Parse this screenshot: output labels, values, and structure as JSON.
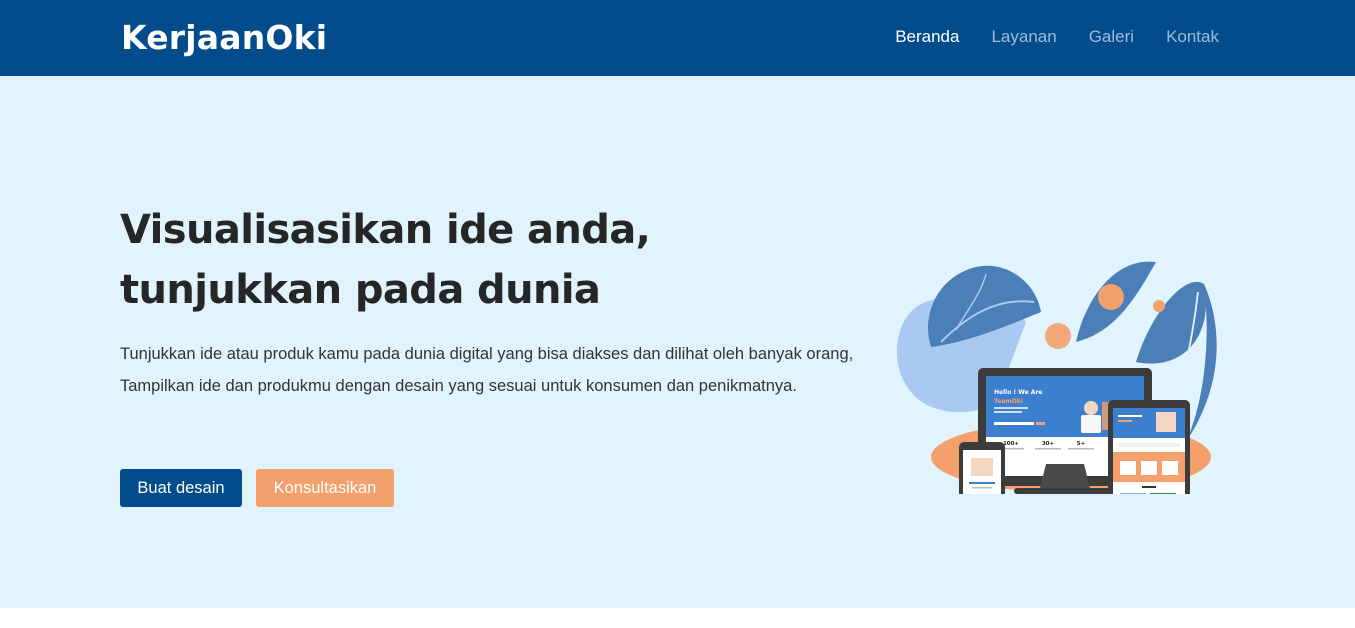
{
  "header": {
    "brand": "KerjaanOki",
    "nav": [
      {
        "label": "Beranda",
        "active": true
      },
      {
        "label": "Layanan",
        "active": false
      },
      {
        "label": "Galeri",
        "active": false
      },
      {
        "label": "Kontak",
        "active": false
      }
    ]
  },
  "hero": {
    "headline_line1": "Visualisasikan ide anda,",
    "headline_line2": "tunjukkan pada dunia",
    "description": "Tunjukkan ide atau produk kamu pada dunia digital yang bisa diakses dan dilihat oleh banyak orang, Tampilkan ide dan produkmu dengan desain yang sesuai untuk konsumen dan penikmatnya.",
    "primary_button": "Buat desain",
    "secondary_button": "Konsultasikan"
  },
  "illustration": {
    "monitor_heading": "Hello ! We Are",
    "monitor_brand": "TeamOki",
    "stats": [
      "100+",
      "30+",
      "5+"
    ]
  },
  "colors": {
    "navbar": "#034c8c",
    "hero_background": "#e1f4fd",
    "accent_orange": "#f4a06c",
    "leaf_blue": "#4a7fb8"
  }
}
